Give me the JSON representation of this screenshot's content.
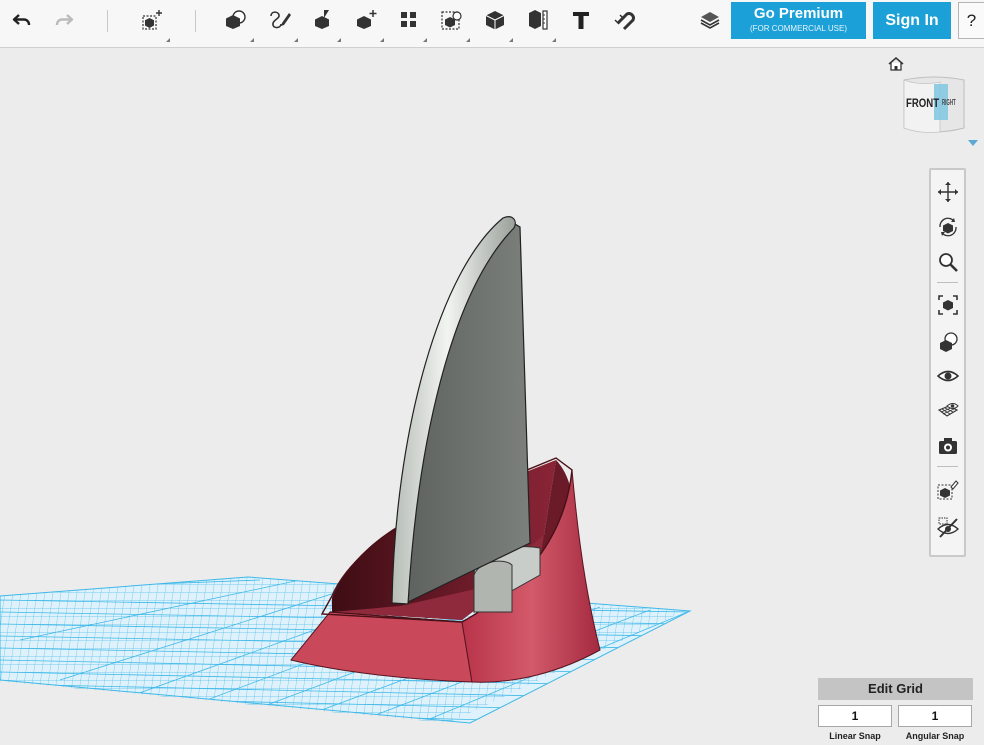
{
  "toolbar": {
    "left_tools": [
      {
        "name": "undo-icon"
      },
      {
        "name": "redo-icon"
      },
      {
        "name": "transform-icon"
      }
    ],
    "center_tools": [
      {
        "name": "primitives-icon"
      },
      {
        "name": "sketch-icon"
      },
      {
        "name": "construct-icon"
      },
      {
        "name": "modify-icon"
      },
      {
        "name": "pattern-icon"
      },
      {
        "name": "grouping-icon"
      },
      {
        "name": "combine-icon"
      },
      {
        "name": "measure-icon"
      },
      {
        "name": "text-icon"
      },
      {
        "name": "snap-icon"
      }
    ],
    "material_icon": "material-icon",
    "premium": {
      "label": "Go Premium",
      "sublabel": "(FOR COMMERCIAL USE)"
    },
    "signin_label": "Sign In",
    "help_label": "?"
  },
  "view_cube": {
    "front_label": "FRONT",
    "right_label": "RIGHT"
  },
  "nav_tools": [
    "pan-icon",
    "orbit-icon",
    "zoom-icon",
    "fit-icon",
    "ortho-icon",
    "visibility-icon",
    "grid-view-icon",
    "screenshot-icon",
    "material-edit-icon",
    "hide-icon"
  ],
  "grid": {
    "edit_label": "Edit Grid",
    "linear_snap_value": "1",
    "angular_snap_value": "1",
    "linear_snap_label": "Linear Snap",
    "angular_snap_label": "Angular Snap"
  },
  "colors": {
    "accent": "#1ca0d8",
    "base_red": "#c84456",
    "sail_gray": "#6f7470",
    "grid_blue": "#3db8e8"
  }
}
